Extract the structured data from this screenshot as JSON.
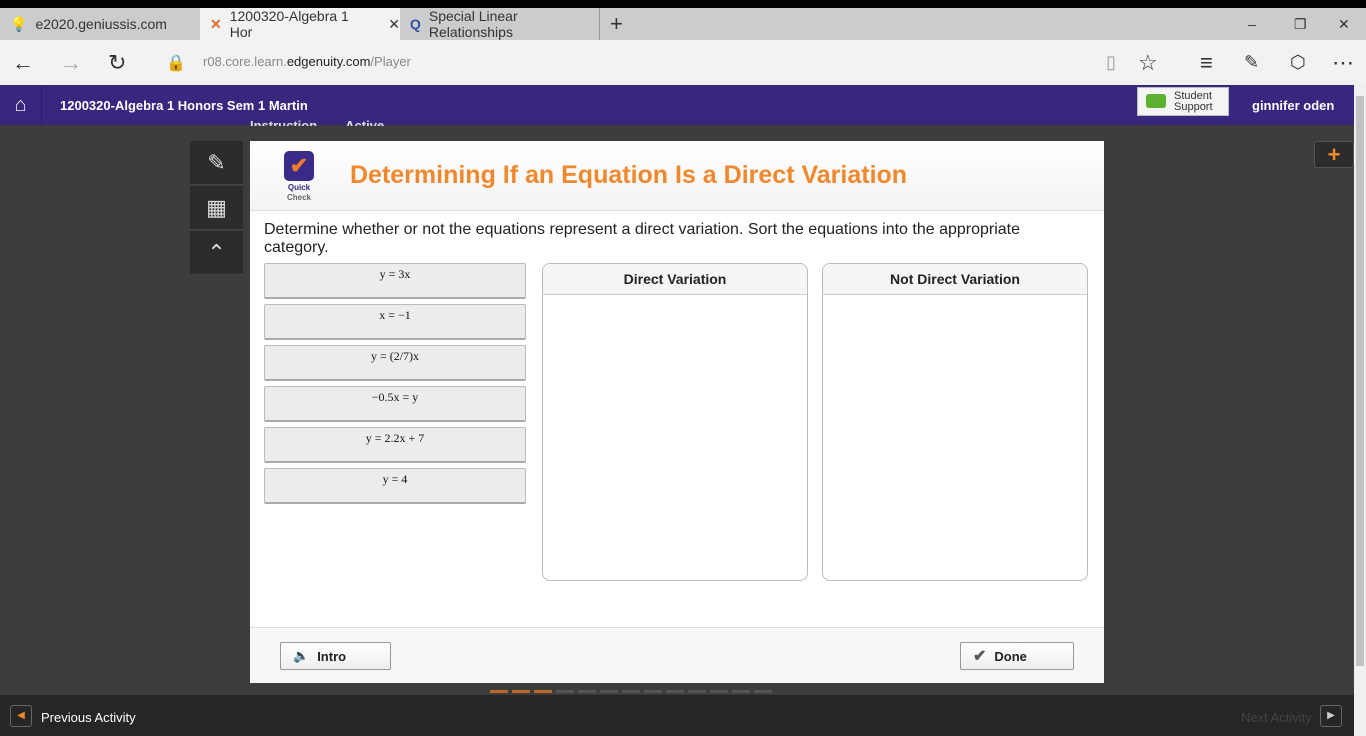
{
  "browser": {
    "tabs": [
      {
        "title": "e2020.geniussis.com"
      },
      {
        "title": "1200320-Algebra 1 Hor"
      },
      {
        "title": "Special Linear Relationships"
      }
    ],
    "url_prefix": "r08.core.learn.",
    "url_domain": "edgenuity.com",
    "url_path": "/Player"
  },
  "header": {
    "course": "1200320-Algebra 1 Honors Sem 1 Martin",
    "support_line1": "Student",
    "support_line2": "Support",
    "user": "ginnifer oden",
    "behind1": "Instruction",
    "behind2": "Active"
  },
  "card": {
    "badge1": "Quick",
    "badge2": "Check",
    "title": "Determining If an Equation Is a Direct Variation",
    "instructions": "Determine whether or not the equations represent a direct variation. Sort the equations into the appropriate category.",
    "equations": [
      "y = 3x",
      "x = −1",
      "y = (2/7)x",
      "−0.5x = y",
      "y = 2.2x + 7",
      "y = 4"
    ],
    "bins": [
      "Direct Variation",
      "Not Direct Variation"
    ],
    "intro": "Intro",
    "done": "Done"
  },
  "footer": {
    "prev": "Previous Activity",
    "next": "Next Activity"
  }
}
